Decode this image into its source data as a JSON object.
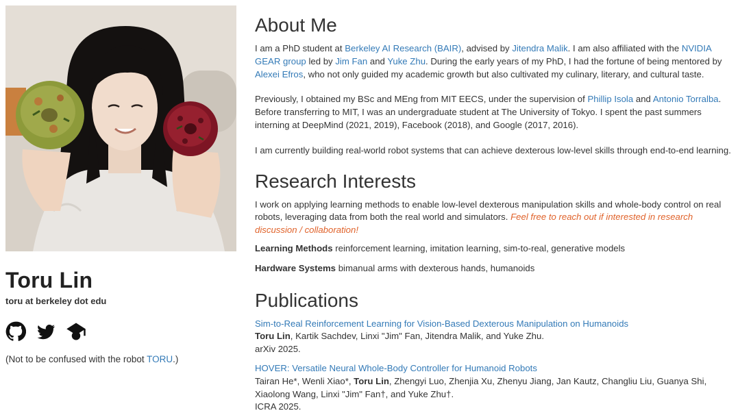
{
  "profile": {
    "name": "Toru Lin",
    "email": "toru at berkeley dot edu",
    "note_prefix": "(Not to be confused with the robot ",
    "note_link": "TORU",
    "note_suffix": ".)",
    "social_icons": [
      "github-icon",
      "twitter-icon",
      "scholar-icon"
    ]
  },
  "about": {
    "heading": "About Me",
    "p1": {
      "t1": "I am a PhD student at ",
      "l1": "Berkeley AI Research (BAIR)",
      "t2": ", advised by ",
      "l2": "Jitendra Malik",
      "t3": ". I am also affiliated with the ",
      "l3": "NVIDIA GEAR group",
      "t4": " led by ",
      "l4": "Jim Fan",
      "t5": " and ",
      "l5": "Yuke Zhu",
      "t6": ". During the early years of my PhD, I had the fortune of being mentored by ",
      "l6": "Alexei Efros",
      "t7": ", who not only guided my academic growth but also cultivated my culinary, literary, and cultural taste."
    },
    "p2": {
      "t1": "Previously, I obtained my BSc and MEng from MIT EECS, under the supervision of ",
      "l1": "Phillip Isola",
      "t2": " and ",
      "l2": "Antonio Torralba",
      "t3": ". Before transferring to MIT, I was an undergraduate student at The University of Tokyo. I spent the past summers interning at DeepMind (2021, 2019), Facebook (2018), and Google (2017, 2016)."
    },
    "p3": "I am currently building real-world robot systems that can achieve dexterous low-level skills through end-to-end learning."
  },
  "research": {
    "heading": "Research Interests",
    "intro": "I work on applying learning methods to enable low-level dexterous manipulation skills and whole-body control on real robots, leveraging data from both the real world and simulators. ",
    "invite": "Feel free to reach out if interested in research discussion / collaboration!",
    "items": [
      {
        "label": "Learning Methods",
        "text": " reinforcement learning, imitation learning, sim-to-real, generative models"
      },
      {
        "label": "Hardware Systems",
        "text": " bimanual arms with dexterous hands, humanoids"
      }
    ]
  },
  "publications": {
    "heading": "Publications",
    "items": [
      {
        "title": "Sim-to-Real Reinforcement Learning for Vision-Based Dexterous Manipulation on Humanoids",
        "authors_before": "",
        "author_self": "Toru Lin",
        "authors_after": ", Kartik Sachdev, Linxi \"Jim\" Fan, Jitendra Malik, and Yuke Zhu.",
        "venue": "arXiv 2025."
      },
      {
        "title": "HOVER: Versatile Neural Whole-Body Controller for Humanoid Robots",
        "authors_before": "Tairan He*, Wenli Xiao*, ",
        "author_self": "Toru Lin",
        "authors_after": ", Zhengyi Luo, Zhenjia Xu, Zhenyu Jiang, Jan Kautz, Changliu Liu, Guanya Shi, Xiaolong Wang, Linxi \"Jim\" Fan†, and Yuke Zhu†.",
        "venue": "ICRA 2025."
      }
    ]
  },
  "colors": {
    "link": "#337ab7",
    "invite": "#e0622a",
    "text": "#333333"
  }
}
